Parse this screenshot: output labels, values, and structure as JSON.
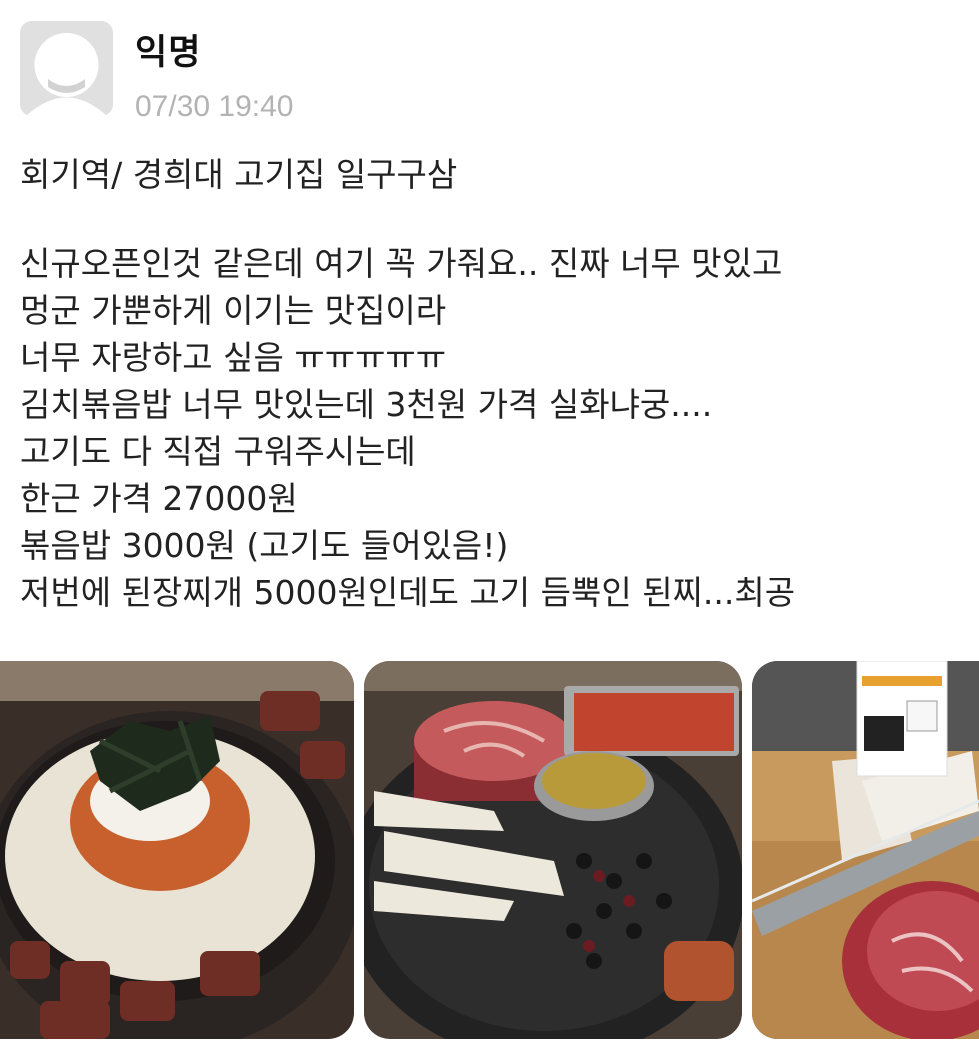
{
  "post": {
    "author": "익명",
    "timestamp": "07/30 19:40",
    "title": "회기역/ 경희대 고기집 일구구삼",
    "body_lines": [
      "신규오픈인것 같은데 여기 꼭 가줘요.. 진짜 너무 맛있고",
      "멍군 가뿐하게 이기는 맛집이라",
      "너무 자랑하고 싶음 ㅠㅠㅠㅠㅠ",
      "김치볶음밥 너무 맛있는데 3천원 가격 실화냐궁....",
      "고기도 다 직접 구워주시는데",
      "한근 가격 27000원",
      "볶음밥 3000원 (고기도 들어있음!)",
      "저번에 된장찌개 5000원인데도 고기 듬뿍인 된찌...최공"
    ]
  },
  "photos": [
    {
      "name": "kimchi-fried-rice-photo"
    },
    {
      "name": "grill-meat-photo"
    },
    {
      "name": "meat-tongs-photo"
    }
  ]
}
